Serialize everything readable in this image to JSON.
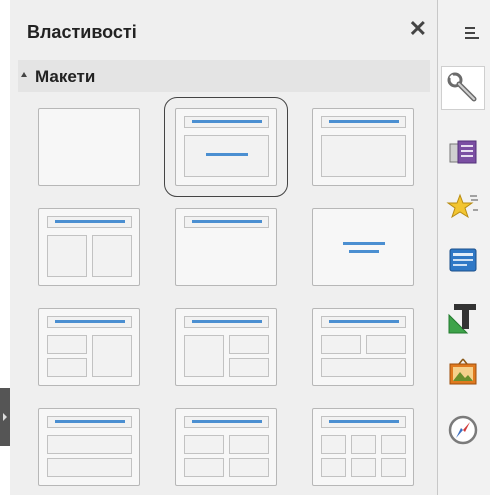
{
  "panel": {
    "title": "Властивості",
    "close_glyph": "✕"
  },
  "section": {
    "title": "Макети",
    "expanded": true
  },
  "layouts": [
    {
      "name": "blank-slide"
    },
    {
      "name": "title-content",
      "selected": true
    },
    {
      "name": "title-content-box"
    },
    {
      "name": "title-two-content"
    },
    {
      "name": "title-only"
    },
    {
      "name": "centered-text"
    },
    {
      "name": "title-content-two-content"
    },
    {
      "name": "title-two-content-content"
    },
    {
      "name": "title-two-content-over-content"
    },
    {
      "name": "title-content-over-content"
    },
    {
      "name": "title-four-content"
    },
    {
      "name": "title-six-content"
    }
  ],
  "sidebar": {
    "menu_icon": "hamburger-menu-icon",
    "decks": [
      {
        "icon": "wrench-properties-icon",
        "active": true
      },
      {
        "icon": "slide-transition-icon"
      },
      {
        "icon": "animation-star-icon"
      },
      {
        "icon": "master-slides-icon"
      },
      {
        "icon": "styles-text-icon"
      },
      {
        "icon": "gallery-icon"
      },
      {
        "icon": "navigator-compass-icon"
      }
    ]
  },
  "colors": {
    "accent": "#4b8fd1",
    "panel_bg": "#efefef"
  }
}
